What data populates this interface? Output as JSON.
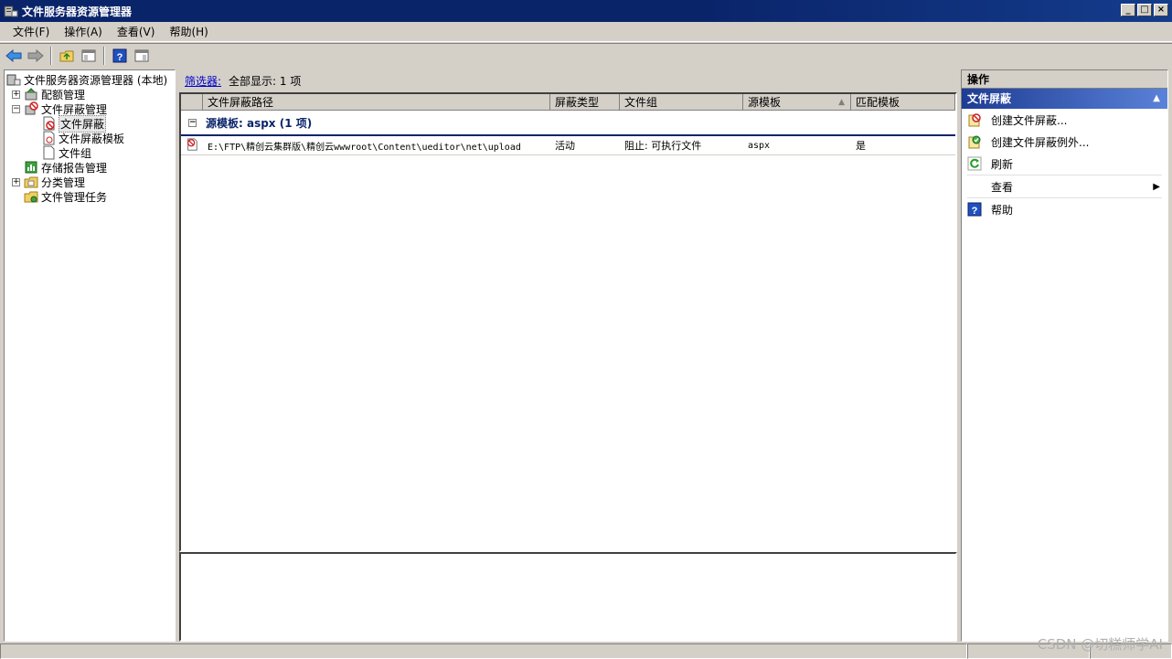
{
  "window": {
    "title": "文件服务器资源管理器",
    "buttons": {
      "minimize": "_",
      "maximize": "□",
      "close": "×"
    }
  },
  "menu": [
    {
      "label": "文件(F)"
    },
    {
      "label": "操作(A)"
    },
    {
      "label": "查看(V)"
    },
    {
      "label": "帮助(H)"
    }
  ],
  "toolbar": {
    "icons": [
      "back-arrow-icon",
      "forward-arrow-icon",
      "up-folder-icon",
      "show-hide-tree-icon",
      "help-icon",
      "show-hide-action-pane-icon"
    ]
  },
  "tree": {
    "root": "文件服务器资源管理器 (本地)",
    "items": [
      {
        "label": "配额管理",
        "expander": "+"
      },
      {
        "label": "文件屏蔽管理",
        "expander": "−"
      },
      {
        "label": "文件屏蔽"
      },
      {
        "label": "文件屏蔽模板"
      },
      {
        "label": "文件组"
      },
      {
        "label": "存储报告管理"
      },
      {
        "label": "分类管理",
        "expander": "+"
      },
      {
        "label": "文件管理任务"
      }
    ]
  },
  "filter": {
    "link": "筛选器:",
    "text": "全部显示: 1 项"
  },
  "list": {
    "columns": [
      "文件屏蔽路径",
      "屏蔽类型",
      "文件组",
      "源模板",
      "匹配模板"
    ],
    "sort_indicator": "▲",
    "group": {
      "expander": "−",
      "label": "源模板: aspx (1 项)"
    },
    "rows": [
      {
        "path": "E:\\FTP\\精创云集群版\\精创云wwwroot\\Content\\ueditor\\net\\upload",
        "type": "活动",
        "file_group": "阻止: 可执行文件",
        "source_template": "aspx",
        "match": "是"
      }
    ]
  },
  "actions": {
    "header": "操作",
    "section": "文件屏蔽",
    "section_toggle": "▲",
    "items": [
      {
        "label": "创建文件屏蔽..."
      },
      {
        "label": "创建文件屏蔽例外..."
      },
      {
        "label": "刷新"
      },
      {
        "label": "查看",
        "submenu": "▶"
      },
      {
        "label": "帮助"
      }
    ]
  },
  "watermark": "CSDN @切糕师学AI",
  "colors": {
    "title_bar": "#0a246a",
    "section_header": "#1e3c94",
    "link": "#0000cc"
  }
}
